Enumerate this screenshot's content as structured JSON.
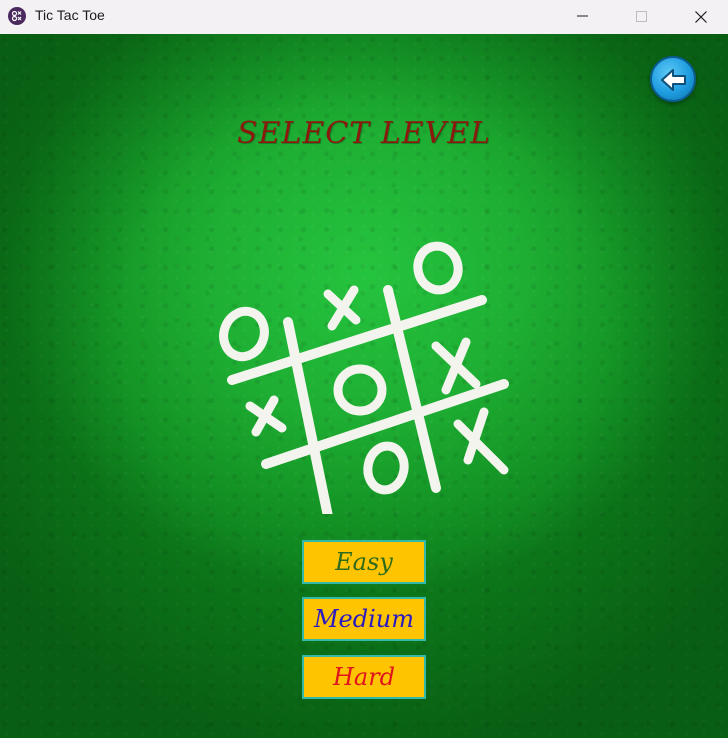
{
  "window": {
    "title": "Tic Tac Toe",
    "controls": [
      "minimize",
      "maximize",
      "close"
    ]
  },
  "screen": {
    "title": "SELECT LEVEL",
    "back_icon": "back-arrow-icon"
  },
  "levels": [
    {
      "label": "Easy",
      "color": "#2f6b1a"
    },
    {
      "label": "Medium",
      "color": "#2a1ac2"
    },
    {
      "label": "Hard",
      "color": "#e0141c"
    }
  ],
  "colors": {
    "background": "#1eae33",
    "title": "#8b1a0e",
    "button_fill": "#ffc400",
    "button_border": "#33b9a9",
    "chalk": "#f4f4ee"
  }
}
